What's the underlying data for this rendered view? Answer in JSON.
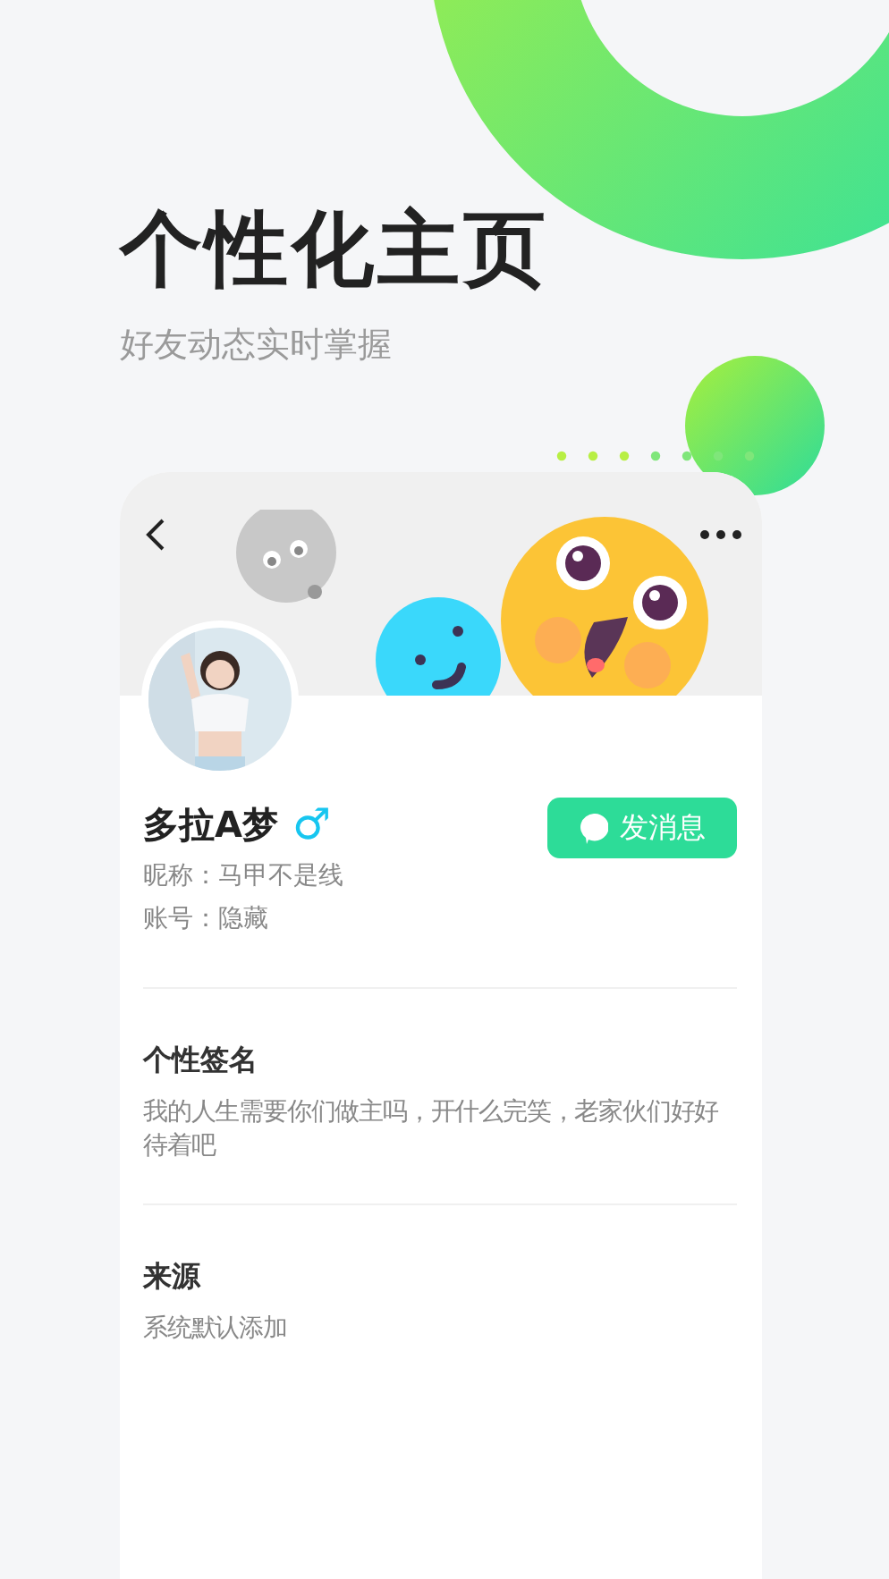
{
  "title": "个性化主页",
  "subtitle": "好友动态实时掌握",
  "profile": {
    "name": "多拉A梦",
    "gender_symbol": "♂",
    "nickname": "昵称：马甲不是线",
    "account": "账号：隐藏",
    "message_button": "发消息"
  },
  "sections": [
    {
      "heading": "个性签名",
      "text": "我的人生需要你们做主吗，开什么完笑，老家伙们好好待着吧"
    },
    {
      "heading": "来源",
      "text": "系统默认添加"
    }
  ]
}
